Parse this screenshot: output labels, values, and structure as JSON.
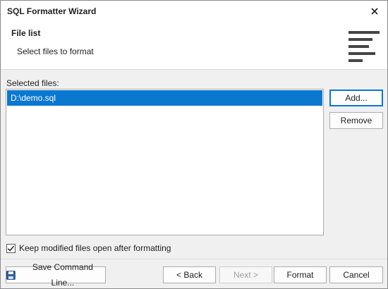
{
  "window": {
    "title": "SQL Formatter Wizard"
  },
  "header": {
    "title": "File list",
    "subtitle": "Select files to format",
    "icon": "text-align-left-icon"
  },
  "files": {
    "label": "Selected files:",
    "items": [
      "D:\\demo.sql"
    ],
    "selected_index": 0
  },
  "side_buttons": {
    "add": "Add...",
    "remove": "Remove"
  },
  "options": {
    "keep_open_label": "Keep modified files open after formatting",
    "keep_open_checked": true
  },
  "footer": {
    "save_command_line": "Save Command Line...",
    "back": "< Back",
    "next": "Next >",
    "format": "Format",
    "cancel": "Cancel"
  },
  "colors": {
    "selection": "#0b78d0",
    "window_bg": "#f0f0f0"
  }
}
